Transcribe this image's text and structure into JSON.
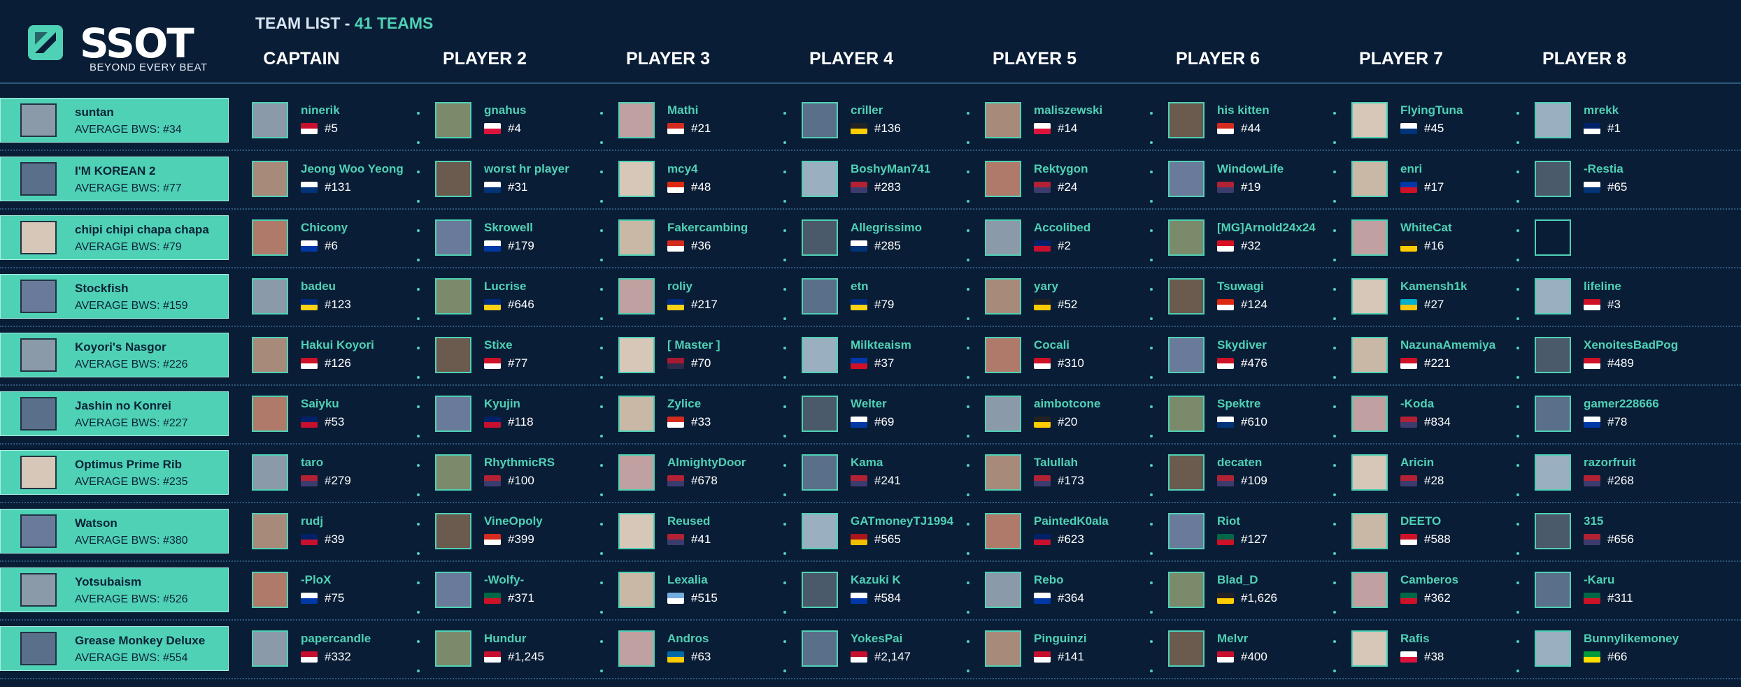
{
  "brand": {
    "logo_text": "SSOT",
    "tagline": "BEYOND EVERY BEAT"
  },
  "title": {
    "label": "TEAM LIST",
    "separator": "-",
    "count": "41 TEAMS"
  },
  "columns": [
    "CAPTAIN",
    "PLAYER 2",
    "PLAYER 3",
    "PLAYER 4",
    "PLAYER 5",
    "PLAYER 6",
    "PLAYER 7",
    "PLAYER 8"
  ],
  "flag_colors": {
    "NO": [
      "#c8102e",
      "#ffffff"
    ],
    "PL": [
      "#ffffff",
      "#dc143c"
    ],
    "CL": [
      "#d52b1e",
      "#ffffff"
    ],
    "DE": [
      "#222222",
      "#ffcc00"
    ],
    "CA": [
      "#d52b1e",
      "#ffffff"
    ],
    "KR": [
      "#ffffff",
      "#003478"
    ],
    "AU": [
      "#012169",
      "#ffffff"
    ],
    "HK": [
      "#de2910",
      "#ffffff"
    ],
    "US": [
      "#b22234",
      "#3c3b6e"
    ],
    "PH": [
      "#0038a8",
      "#ce1126"
    ],
    "RU": [
      "#ffffff",
      "#0039a6"
    ],
    "GB": [
      "#012169",
      "#c8102e"
    ],
    "PE": [
      "#d91023",
      "#ffffff"
    ],
    "RO": [
      "#002b7f",
      "#fcd116"
    ],
    "ID": [
      "#ce1126",
      "#ffffff"
    ],
    "TH": [
      "#a51931",
      "#2d2a4a"
    ],
    "KZ": [
      "#00afca",
      "#fec50c"
    ],
    "NZ": [
      "#012169",
      "#c8102e"
    ],
    "UY": [
      "#ffffff",
      "#0038a8"
    ],
    "MX": [
      "#006847",
      "#ce1126"
    ],
    "AR": [
      "#74acdf",
      "#ffffff"
    ],
    "SE": [
      "#006aa7",
      "#fecc00"
    ],
    "ES": [
      "#aa151b",
      "#f1bf00"
    ],
    "BR": [
      "#009c3b",
      "#ffdf00"
    ]
  },
  "teams": [
    {
      "captain": {
        "name": "suntan",
        "bws": "AVERAGE BWS: #34"
      },
      "players": [
        {
          "name": "ninerik",
          "flag": "NO",
          "rank": "#5"
        },
        {
          "name": "gnahus",
          "flag": "PL",
          "rank": "#4"
        },
        {
          "name": "Mathi",
          "flag": "CL",
          "rank": "#21"
        },
        {
          "name": "criller",
          "flag": "DE",
          "rank": "#136"
        },
        {
          "name": "maliszewski",
          "flag": "PL",
          "rank": "#14"
        },
        {
          "name": "his kitten",
          "flag": "CA",
          "rank": "#44"
        },
        {
          "name": "FlyingTuna",
          "flag": "KR",
          "rank": "#45"
        },
        {
          "name": "mrekk",
          "flag": "AU",
          "rank": "#1"
        }
      ]
    },
    {
      "captain": {
        "name": "I'M KOREAN 2",
        "bws": "AVERAGE BWS: #77"
      },
      "players": [
        {
          "name": "Jeong Woo Yeong",
          "flag": "KR",
          "rank": "#131"
        },
        {
          "name": "worst hr player",
          "flag": "KR",
          "rank": "#31"
        },
        {
          "name": "mcy4",
          "flag": "HK",
          "rank": "#48"
        },
        {
          "name": "BoshyMan741",
          "flag": "US",
          "rank": "#283"
        },
        {
          "name": "Rektygon",
          "flag": "US",
          "rank": "#24"
        },
        {
          "name": "WindowLife",
          "flag": "US",
          "rank": "#19"
        },
        {
          "name": "enri",
          "flag": "PH",
          "rank": "#17"
        },
        {
          "name": "-Restia",
          "flag": "KR",
          "rank": "#65"
        }
      ]
    },
    {
      "captain": {
        "name": "chipi chipi chapa chapa",
        "bws": "AVERAGE BWS: #79"
      },
      "players": [
        {
          "name": "Chicony",
          "flag": "RU",
          "rank": "#6"
        },
        {
          "name": "Skrowell",
          "flag": "RU",
          "rank": "#179"
        },
        {
          "name": "Fakercambing",
          "flag": "CL",
          "rank": "#36"
        },
        {
          "name": "Allegrissimo",
          "flag": "KR",
          "rank": "#285"
        },
        {
          "name": "Accolibed",
          "flag": "GB",
          "rank": "#2"
        },
        {
          "name": "[MG]Arnold24x24",
          "flag": "PE",
          "rank": "#32"
        },
        {
          "name": "WhiteCat",
          "flag": "DE",
          "rank": "#16"
        },
        {
          "name": "",
          "flag": "",
          "rank": ""
        }
      ]
    },
    {
      "captain": {
        "name": "Stockfish",
        "bws": "AVERAGE BWS: #159"
      },
      "players": [
        {
          "name": "badeu",
          "flag": "RO",
          "rank": "#123"
        },
        {
          "name": "Lucrise",
          "flag": "RO",
          "rank": "#646"
        },
        {
          "name": "roliy",
          "flag": "RO",
          "rank": "#217"
        },
        {
          "name": "etn",
          "flag": "RO",
          "rank": "#79"
        },
        {
          "name": "yary",
          "flag": "DE",
          "rank": "#52"
        },
        {
          "name": "Tsuwagi",
          "flag": "HK",
          "rank": "#124"
        },
        {
          "name": "Kamensh1k",
          "flag": "KZ",
          "rank": "#27"
        },
        {
          "name": "lifeline",
          "flag": "ID",
          "rank": "#3"
        }
      ]
    },
    {
      "captain": {
        "name": "Koyori's Nasgor",
        "bws": "AVERAGE BWS: #226"
      },
      "players": [
        {
          "name": "Hakui Koyori",
          "flag": "ID",
          "rank": "#126"
        },
        {
          "name": "Stixe",
          "flag": "ID",
          "rank": "#77"
        },
        {
          "name": "[ Master ]",
          "flag": "TH",
          "rank": "#70"
        },
        {
          "name": "Milkteaism",
          "flag": "PH",
          "rank": "#37"
        },
        {
          "name": "Cocali",
          "flag": "ID",
          "rank": "#310"
        },
        {
          "name": "Skydiver",
          "flag": "ID",
          "rank": "#476"
        },
        {
          "name": "NazunaAmemiya",
          "flag": "ID",
          "rank": "#221"
        },
        {
          "name": "XenoitesBadPog",
          "flag": "ID",
          "rank": "#489"
        }
      ]
    },
    {
      "captain": {
        "name": "Jashin no Konrei",
        "bws": "AVERAGE BWS: #227"
      },
      "players": [
        {
          "name": "Saiyku",
          "flag": "NZ",
          "rank": "#53"
        },
        {
          "name": "Kyujin",
          "flag": "NZ",
          "rank": "#118"
        },
        {
          "name": "Zylice",
          "flag": "CA",
          "rank": "#33"
        },
        {
          "name": "Welter",
          "flag": "RU",
          "rank": "#69"
        },
        {
          "name": "aimbotcone",
          "flag": "DE",
          "rank": "#20"
        },
        {
          "name": "Spektre",
          "flag": "KR",
          "rank": "#610"
        },
        {
          "name": "-Koda",
          "flag": "US",
          "rank": "#834"
        },
        {
          "name": "gamer228666",
          "flag": "RU",
          "rank": "#78"
        }
      ]
    },
    {
      "captain": {
        "name": "Optimus Prime Rib",
        "bws": "AVERAGE BWS: #235"
      },
      "players": [
        {
          "name": "taro",
          "flag": "US",
          "rank": "#279"
        },
        {
          "name": "RhythmicRS",
          "flag": "US",
          "rank": "#100"
        },
        {
          "name": "AlmightyDoor",
          "flag": "US",
          "rank": "#678"
        },
        {
          "name": "Kama",
          "flag": "US",
          "rank": "#241"
        },
        {
          "name": "Talullah",
          "flag": "US",
          "rank": "#173"
        },
        {
          "name": "decaten",
          "flag": "US",
          "rank": "#109"
        },
        {
          "name": "Aricin",
          "flag": "US",
          "rank": "#28"
        },
        {
          "name": "razorfruit",
          "flag": "US",
          "rank": "#268"
        }
      ]
    },
    {
      "captain": {
        "name": "Watson",
        "bws": "AVERAGE BWS: #380"
      },
      "players": [
        {
          "name": "rudj",
          "flag": "GB",
          "rank": "#39"
        },
        {
          "name": "VineOpoly",
          "flag": "CA",
          "rank": "#399"
        },
        {
          "name": "Reused",
          "flag": "US",
          "rank": "#41"
        },
        {
          "name": "GATmoneyTJ1994",
          "flag": "ES",
          "rank": "#565"
        },
        {
          "name": "PaintedK0ala",
          "flag": "GB",
          "rank": "#623"
        },
        {
          "name": "Riot",
          "flag": "MX",
          "rank": "#127"
        },
        {
          "name": "DEETO",
          "flag": "ID",
          "rank": "#588"
        },
        {
          "name": "315",
          "flag": "US",
          "rank": "#656"
        }
      ]
    },
    {
      "captain": {
        "name": "Yotsubaism",
        "bws": "AVERAGE BWS: #526"
      },
      "players": [
        {
          "name": "-PloX",
          "flag": "UY",
          "rank": "#75"
        },
        {
          "name": "-Wolfy-",
          "flag": "MX",
          "rank": "#371"
        },
        {
          "name": "Lexalia",
          "flag": "AR",
          "rank": "#515"
        },
        {
          "name": "Kazuki K",
          "flag": "UY",
          "rank": "#584"
        },
        {
          "name": "Rebo",
          "flag": "UY",
          "rank": "#364"
        },
        {
          "name": "Blad_D",
          "flag": "DE",
          "rank": "#1,626"
        },
        {
          "name": "Camberos",
          "flag": "MX",
          "rank": "#362"
        },
        {
          "name": "-Karu",
          "flag": "MX",
          "rank": "#311"
        }
      ]
    },
    {
      "captain": {
        "name": "Grease Monkey Deluxe",
        "bws": "AVERAGE BWS: #554"
      },
      "players": [
        {
          "name": "papercandle",
          "flag": "NO",
          "rank": "#332"
        },
        {
          "name": "Hundur",
          "flag": "NO",
          "rank": "#1,245"
        },
        {
          "name": "Andros",
          "flag": "SE",
          "rank": "#63"
        },
        {
          "name": "YokesPai",
          "flag": "NO",
          "rank": "#2,147"
        },
        {
          "name": "Pinguinzi",
          "flag": "NO",
          "rank": "#141"
        },
        {
          "name": "Melvr",
          "flag": "NO",
          "rank": "#400"
        },
        {
          "name": "Rafis",
          "flag": "PL",
          "rank": "#38"
        },
        {
          "name": "Bunnylikemoney",
          "flag": "BR",
          "rank": "#66"
        }
      ]
    }
  ]
}
